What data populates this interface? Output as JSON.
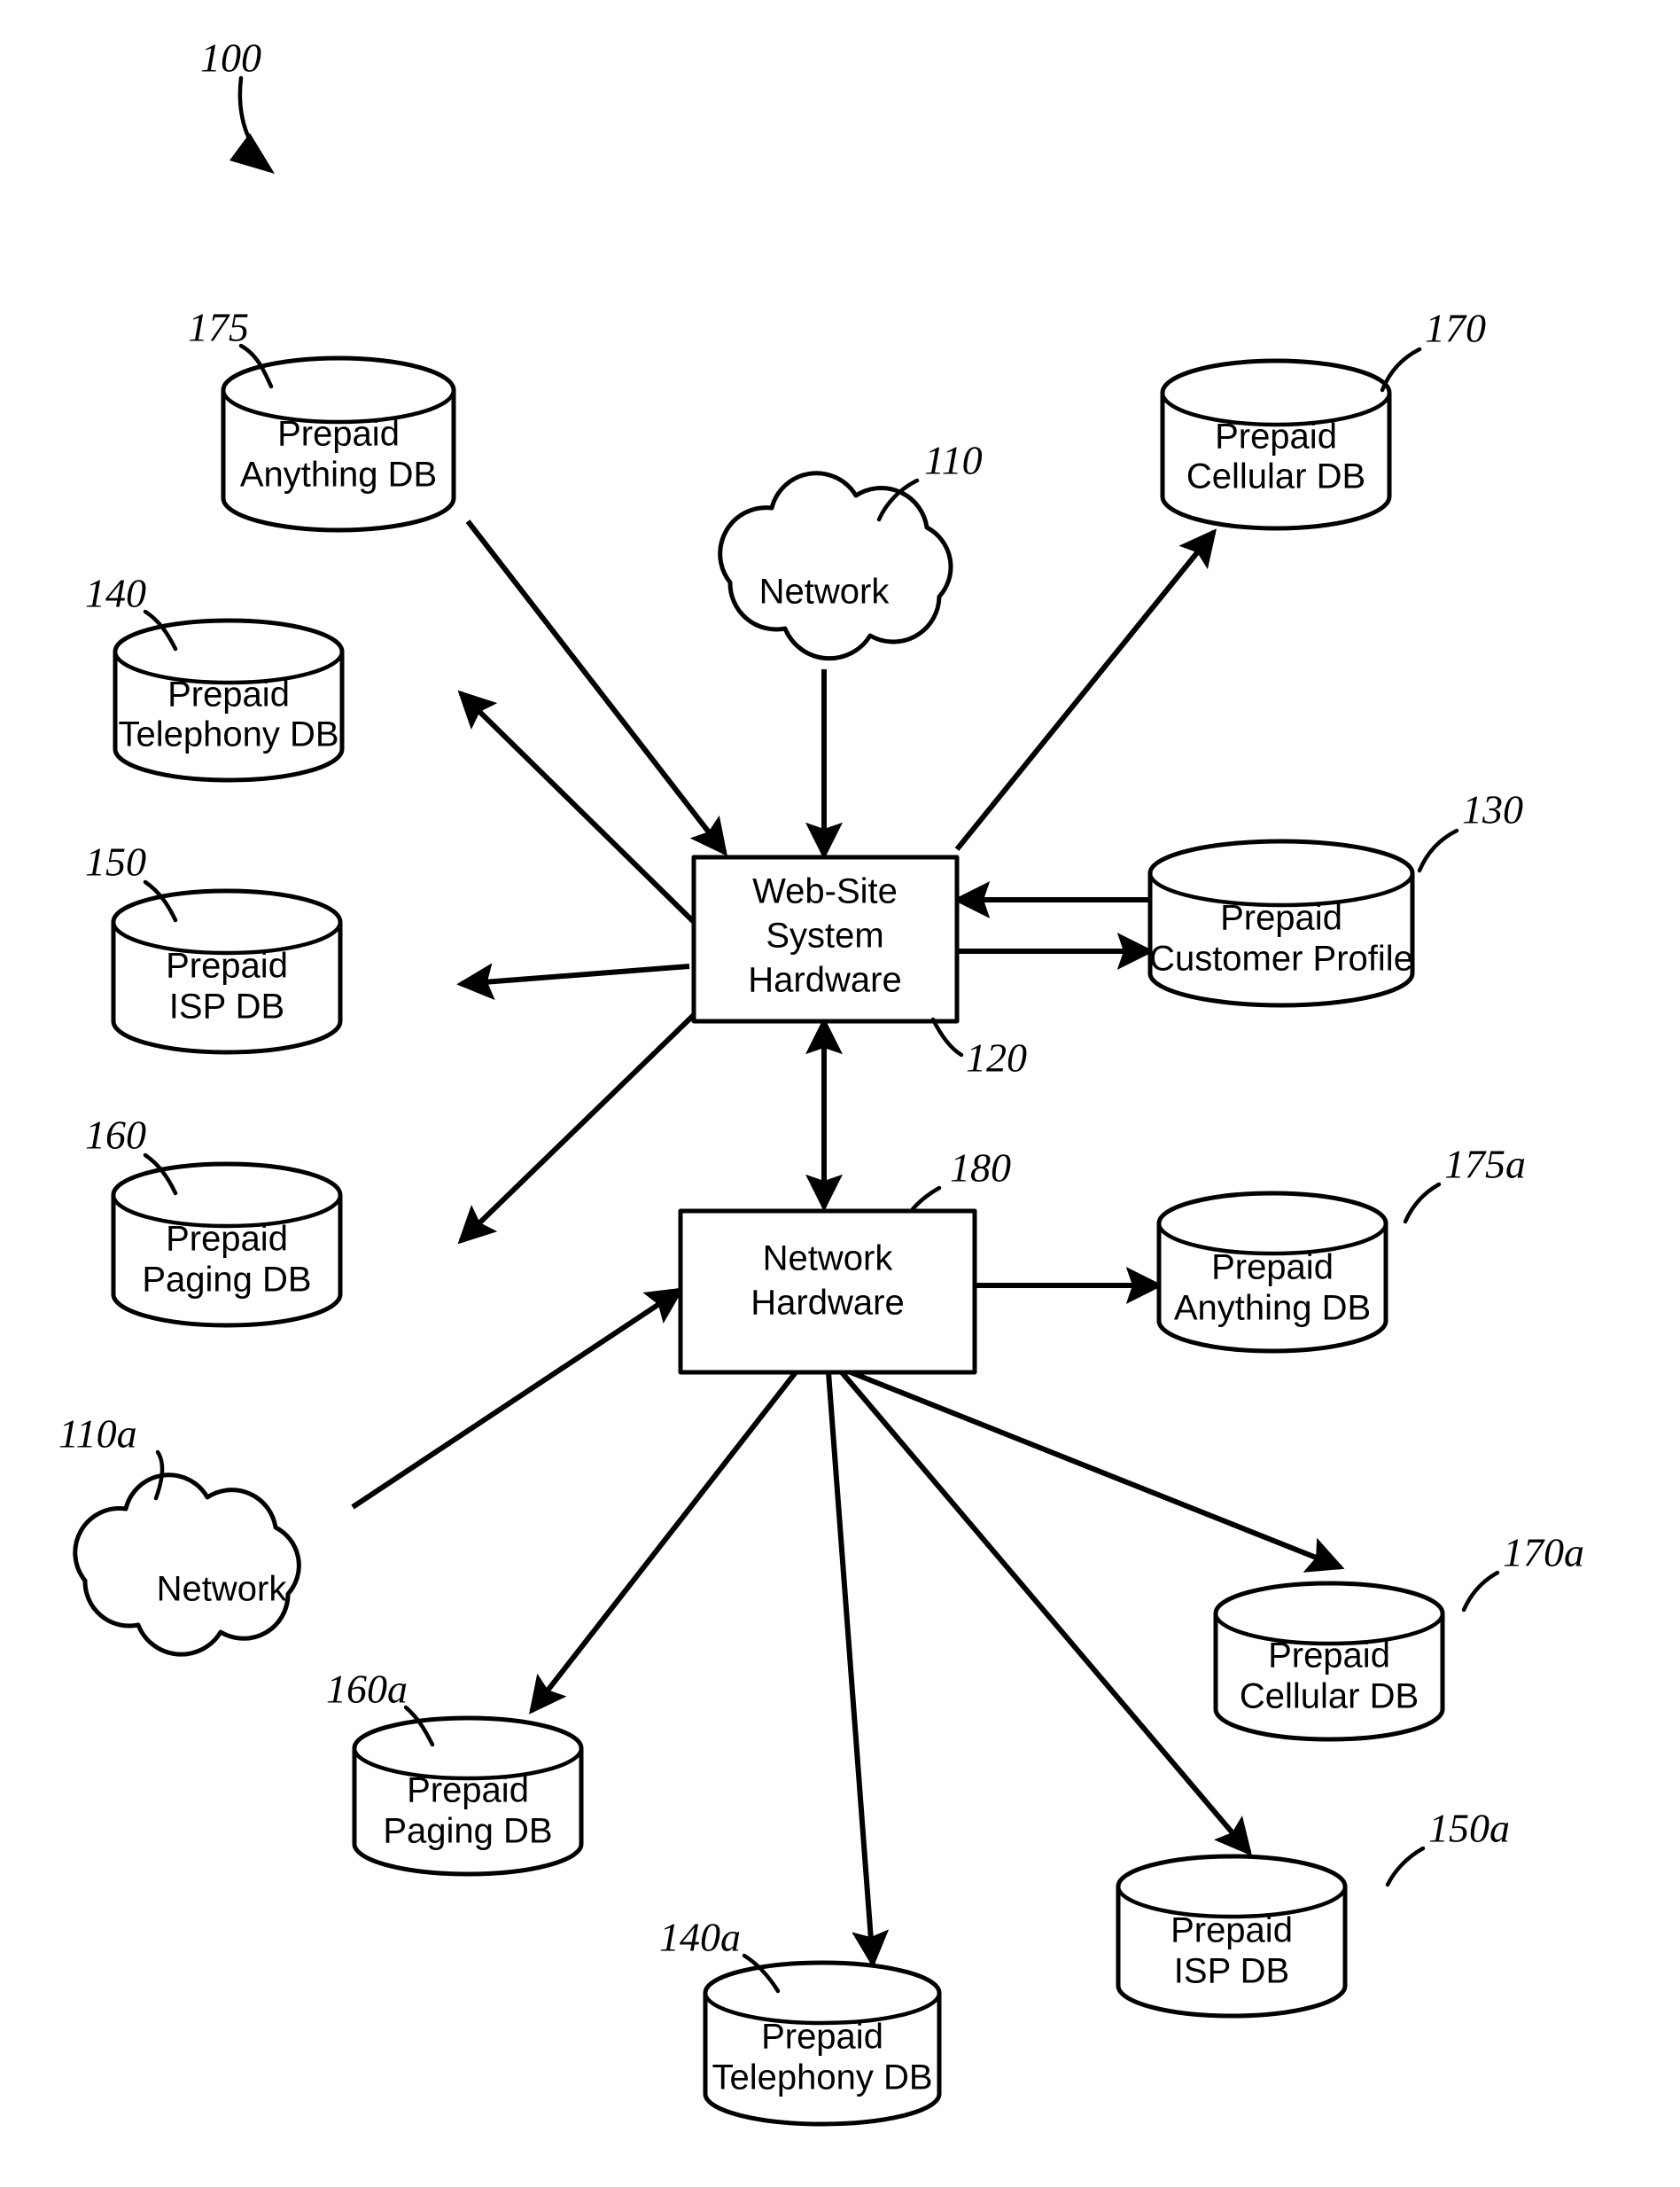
{
  "figure": {
    "figure_ref": "100",
    "background_color": "#ffffff",
    "line_color": "#000000"
  },
  "nodes": [
    {
      "id": "n110",
      "ref": "110",
      "shape": "cloud",
      "label_line1": "Network",
      "label_line2": ""
    },
    {
      "id": "n110a",
      "ref": "110a",
      "shape": "cloud",
      "label_line1": "Network",
      "label_line2": ""
    },
    {
      "id": "n120",
      "ref": "120",
      "shape": "box",
      "label_line1": "Web-Site",
      "label_line2": "System",
      "label_line3": "Hardware"
    },
    {
      "id": "n180",
      "ref": "180",
      "shape": "box",
      "label_line1": "Network",
      "label_line2": "Hardware"
    },
    {
      "id": "n130",
      "ref": "130",
      "shape": "cylinder",
      "label_line1": "Prepaid",
      "label_line2": "Customer Profile"
    },
    {
      "id": "n140",
      "ref": "140",
      "shape": "cylinder",
      "label_line1": "Prepaid",
      "label_line2": "Telephony DB"
    },
    {
      "id": "n140a",
      "ref": "140a",
      "shape": "cylinder",
      "label_line1": "Prepaid",
      "label_line2": "Telephony DB"
    },
    {
      "id": "n150",
      "ref": "150",
      "shape": "cylinder",
      "label_line1": "Prepaid",
      "label_line2": "ISP DB"
    },
    {
      "id": "n150a",
      "ref": "150a",
      "shape": "cylinder",
      "label_line1": "Prepaid",
      "label_line2": "ISP DB"
    },
    {
      "id": "n160",
      "ref": "160",
      "shape": "cylinder",
      "label_line1": "Prepaid",
      "label_line2": "Paging DB"
    },
    {
      "id": "n160a",
      "ref": "160a",
      "shape": "cylinder",
      "label_line1": "Prepaid",
      "label_line2": "Paging DB"
    },
    {
      "id": "n170",
      "ref": "170",
      "shape": "cylinder",
      "label_line1": "Prepaid",
      "label_line2": "Cellular DB"
    },
    {
      "id": "n170a",
      "ref": "170a",
      "shape": "cylinder",
      "label_line1": "Prepaid",
      "label_line2": "Cellular DB"
    },
    {
      "id": "n175",
      "ref": "175",
      "shape": "cylinder",
      "label_line1": "Prepaid",
      "label_line2": "Anything DB"
    },
    {
      "id": "n175a",
      "ref": "175a",
      "shape": "cylinder",
      "label_line1": "Prepaid",
      "label_line2": "Anything DB"
    }
  ],
  "labels": {
    "fig100": "100",
    "ref110": "110",
    "ref110a": "110a",
    "ref120": "120",
    "ref130": "130",
    "ref140": "140",
    "ref140a": "140a",
    "ref150": "150",
    "ref150a": "150a",
    "ref160": "160",
    "ref160a": "160a",
    "ref170": "170",
    "ref170a": "170a",
    "ref175": "175",
    "ref175a": "175a",
    "ref180": "180",
    "network": "Network",
    "websiteL1": "Web-Site",
    "websiteL2": "System",
    "websiteL3": "Hardware",
    "nethwL1": "Network",
    "nethwL2": "Hardware",
    "prepaid": "Prepaid",
    "customerProfile": "Customer Profile",
    "telephonyDB": "Telephony DB",
    "ispDB": "ISP DB",
    "pagingDB": "Paging DB",
    "cellularDB": "Cellular DB",
    "anythingDB": "Anything DB"
  },
  "connections": [
    {
      "from": "n110",
      "to": "n120",
      "direction": "one-way"
    },
    {
      "from": "n175",
      "to": "n120",
      "direction": "one-way"
    },
    {
      "from": "n120",
      "to": "n170",
      "direction": "one-way"
    },
    {
      "from": "n120",
      "to": "n140",
      "direction": "one-way"
    },
    {
      "from": "n120",
      "to": "n150",
      "direction": "one-way"
    },
    {
      "from": "n120",
      "to": "n160",
      "direction": "one-way"
    },
    {
      "from": "n130",
      "to": "n120",
      "direction": "two-way"
    },
    {
      "from": "n120",
      "to": "n180",
      "direction": "two-way"
    },
    {
      "from": "n110a",
      "to": "n180",
      "direction": "one-way"
    },
    {
      "from": "n180",
      "to": "n175a",
      "direction": "one-way"
    },
    {
      "from": "n180",
      "to": "n160a",
      "direction": "one-way"
    },
    {
      "from": "n180",
      "to": "n140a",
      "direction": "one-way"
    },
    {
      "from": "n180",
      "to": "n150a",
      "direction": "one-way"
    },
    {
      "from": "n180",
      "to": "n170a",
      "direction": "one-way"
    }
  ]
}
